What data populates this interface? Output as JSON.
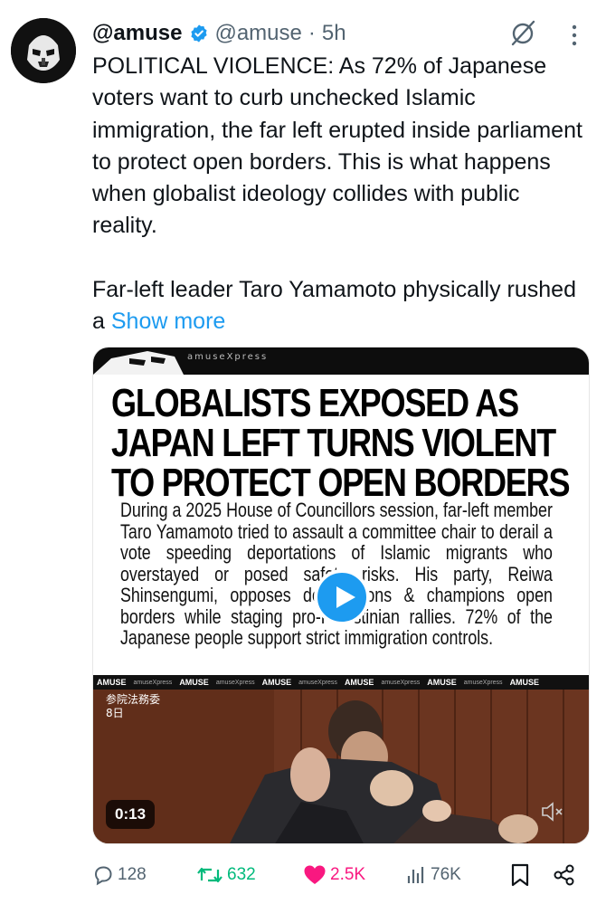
{
  "tweet": {
    "display_name": "@amuse",
    "handle": "@amuse",
    "separator": "·",
    "time": "5h",
    "text_para1": "POLITICAL VIOLENCE: As 72% of Japanese voters want to curb unchecked Islamic immigration, the far left erupted inside parliament to protect open borders. This is what happens when globalist ideology collides with public reality.",
    "text_para2": "Far-left leader Taro Yamamoto physically rushed a",
    "show_more": "Show more"
  },
  "media": {
    "brand": "amuseXpress",
    "headline": "GLOBALISTS EXPOSED AS JAPAN LEFT TURNS VIOLENT TO PROTECT OPEN BORDERS",
    "summary": "During a 2025 House of Councillors session, far-left member Taro Yamamoto tried to assault a committee chair to derail a vote speeding deportations of Islamic migrants who overstayed or posed safety risks. His party, Reiwa Shinsengumi, opposes deportations & champions open borders while staging pro-Palestinian rallies. 72% of the Japanese people support strict immigration controls.",
    "ticker_label": "AMUSE",
    "ticker_sub": "amuseXpress",
    "caption_line1": "参院法務委",
    "caption_line2": "8日",
    "duration": "0:13"
  },
  "actions": {
    "replies": "128",
    "reposts": "632",
    "likes": "2.5K",
    "views": "76K"
  },
  "colors": {
    "accent": "#1d9bf0",
    "repost": "#00ba7c",
    "like": "#f91880",
    "muted": "#536471"
  },
  "icons": [
    "avatar-stormtrooper",
    "verified-badge-icon",
    "grok-icon",
    "more-options-icon",
    "play-icon",
    "mute-icon",
    "reply-icon",
    "repost-icon",
    "like-icon",
    "views-icon",
    "bookmark-icon",
    "share-icon"
  ]
}
